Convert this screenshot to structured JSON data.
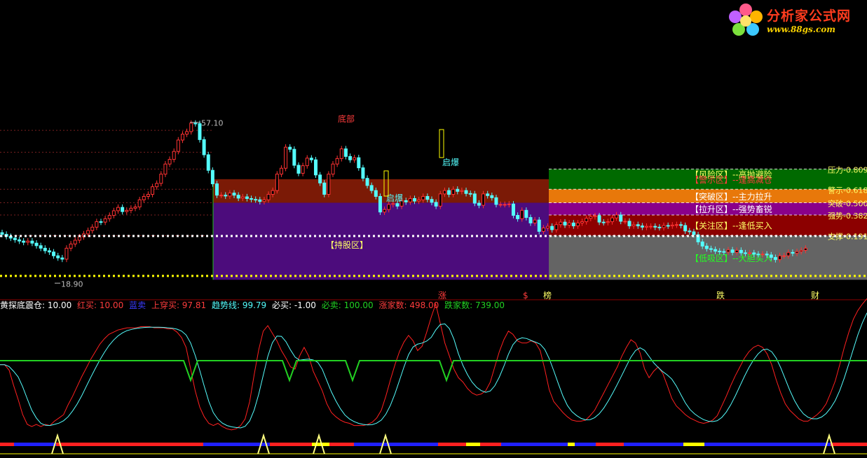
{
  "logo": {
    "title": "分析家公式网",
    "url": "www.88gs.com"
  },
  "colors": {
    "up": "#ff3232",
    "down": "#54fcfc",
    "green": "#22c022",
    "risk": "#7a7a00",
    "warn": "#006a00",
    "break": "#e8780a",
    "pull": "#8a008a",
    "focus": "#8c0000",
    "low": "#646464",
    "hold_upper": "#7b1a06",
    "hold_lower": "#4c0c7c"
  },
  "chart_data": {
    "type": "candlestick",
    "price_high_label": "57.10",
    "price_low_label": "18.90",
    "zones": [
      {
        "name": "【风险区】--高抛避险",
        "color": "#7a7a00"
      },
      {
        "name": "【警示区】--逢高减仓",
        "color": "#006a00"
      },
      {
        "name": "【突破区】--主力拉升",
        "color": "#e8780a"
      },
      {
        "name": "【拉升区】--强势畜锐",
        "color": "#8a008a"
      },
      {
        "name": "【关注区】--逢低买入",
        "color": "#8c0000"
      },
      {
        "name": "【低吸区】--大胆买入",
        "color": "#646464"
      }
    ],
    "fib_levels": [
      {
        "label": "压力-0.809",
        "price": 46.0
      },
      {
        "label": "警示-0.618",
        "price": 41.2
      },
      {
        "label": "突破-0.500",
        "price": 38.0
      },
      {
        "label": "强势-0.382",
        "price": 35.1
      },
      {
        "label": "支撑-0.191",
        "price": 30.2
      }
    ],
    "hold_zone_label": "【持股区】",
    "signal_labels": [
      "底部",
      "启爆",
      "启爆"
    ],
    "markers": [
      "涨",
      "$",
      "榜",
      "跌",
      "财"
    ],
    "indicator_legend": [
      {
        "text": "黄探底震仓: 10.00",
        "color": "#ffffff"
      },
      {
        "text": "红买: 10.00",
        "color": "#ff3c3c"
      },
      {
        "text": "蓝卖",
        "color": "#3c3cff"
      },
      {
        "text": "上穿买: 97.81",
        "color": "#ff3c3c"
      },
      {
        "text": "趋势线: 99.79",
        "color": "#54fcfc"
      },
      {
        "text": "必买: -1.00",
        "color": "#ffffff"
      },
      {
        "text": "必卖: 100.00",
        "color": "#22d022"
      },
      {
        "text": "涨家数: 498.00",
        "color": "#ff3c3c"
      },
      {
        "text": "跌家数: 739.00",
        "color": "#22d022"
      }
    ],
    "closes": [
      30.5,
      30.0,
      29.6,
      29.2,
      28.9,
      28.6,
      28.9,
      28.4,
      27.8,
      27.2,
      26.6,
      26.3,
      25.4,
      24.9,
      24.6,
      27.2,
      28.2,
      29.1,
      29.9,
      30.6,
      31.4,
      32.2,
      33.5,
      33.4,
      34.2,
      35.0,
      36.1,
      36.9,
      35.9,
      36.2,
      36.7,
      37.0,
      38.7,
      39.5,
      40.0,
      41.8,
      42.6,
      44.8,
      47.2,
      48.3,
      50.2,
      52.9,
      54.3,
      54.9,
      56.9,
      56.8,
      53.0,
      49.4,
      45.7,
      42.5,
      39.8,
      39.8,
      39.6,
      40.3,
      39.8,
      39.1,
      39.4,
      39.0,
      38.8,
      38.7,
      38.3,
      38.7,
      40.0,
      40.9,
      44.8,
      46.2,
      51.2,
      50.7,
      46.9,
      45.0,
      46.8,
      48.6,
      48.2,
      44.6,
      42.7,
      40.0,
      44.8,
      47.2,
      48.5,
      50.8,
      49.0,
      48.2,
      48.7,
      46.3,
      43.8,
      42.1,
      40.9,
      39.5,
      35.8,
      36.4,
      37.6,
      37.8,
      37.2,
      38.5,
      38.2,
      39.0,
      38.4,
      38.7,
      39.5,
      38.8,
      38.1,
      37.2,
      40.1,
      40.9,
      40.0,
      41.2,
      40.7,
      40.9,
      40.2,
      40.1,
      37.9,
      37.4,
      40.1,
      39.7,
      39.2,
      37.6,
      37.6,
      37.6,
      37.7,
      35.0,
      34.2,
      36.2,
      34.5,
      33.2,
      33.9,
      31.2,
      32.0,
      32.4,
      31.6,
      32.8,
      33.4,
      32.7,
      33.2,
      32.5,
      33.2,
      33.5,
      34.3,
      34.7,
      34.9,
      33.4,
      33.3,
      33.5,
      34.4,
      35.1,
      33.6,
      33.6,
      32.5,
      32.8,
      32.5,
      32.2,
      32.4,
      32.4,
      32.2,
      32.1,
      32.6,
      32.5,
      32.7,
      32.8,
      32.6,
      31.3,
      31.1,
      30.4,
      28.7,
      27.7,
      27.1,
      26.9,
      26.5,
      26.4,
      26.3,
      26.8,
      26.2,
      26.7,
      26.1,
      26.0,
      26.1,
      25.8,
      25.7,
      25.8,
      25.6,
      25.0,
      24.5,
      25.4,
      25.4,
      26.2,
      26.0,
      26.4,
      26.7,
      27.2
    ]
  },
  "indicator_data": {
    "red": [
      64,
      64,
      59,
      45,
      32,
      18,
      9,
      7,
      9,
      7,
      9,
      8,
      12,
      15,
      18,
      27,
      35,
      44,
      53,
      61,
      69,
      76,
      83,
      88,
      92,
      94,
      96,
      97,
      98,
      98,
      98,
      99,
      99,
      99,
      98,
      98,
      98,
      97,
      97,
      94,
      89,
      80,
      60,
      40,
      25,
      16,
      10,
      8,
      10,
      7,
      5,
      4,
      5,
      8,
      14,
      30,
      55,
      78,
      95,
      100,
      93,
      86,
      77,
      70,
      62,
      60,
      72,
      80,
      72,
      58,
      49,
      40,
      28,
      20,
      16,
      13,
      11,
      10,
      8,
      8,
      8,
      9,
      11,
      15,
      22,
      35,
      50,
      64,
      76,
      85,
      91,
      86,
      77,
      81,
      94,
      108,
      120,
      102,
      84,
      72,
      60,
      52,
      48,
      42,
      38,
      36,
      37,
      40,
      48,
      62,
      76,
      87,
      95,
      92,
      86,
      84,
      84,
      86,
      84,
      77,
      60,
      41,
      30,
      25,
      20,
      16,
      13,
      12,
      12,
      13,
      17,
      22,
      30,
      38,
      46,
      54,
      62,
      72,
      80,
      87,
      84,
      75,
      60,
      52,
      58,
      62,
      56,
      45,
      33,
      26,
      22,
      18,
      15,
      13,
      11,
      10,
      11,
      13,
      17,
      26,
      35,
      45,
      54,
      62,
      70,
      76,
      80,
      82,
      80,
      74,
      64,
      50,
      38,
      28,
      22,
      18,
      14,
      12,
      12,
      15,
      18,
      22,
      28,
      38,
      49,
      64,
      80,
      94,
      106,
      114,
      120,
      125
    ]
  }
}
